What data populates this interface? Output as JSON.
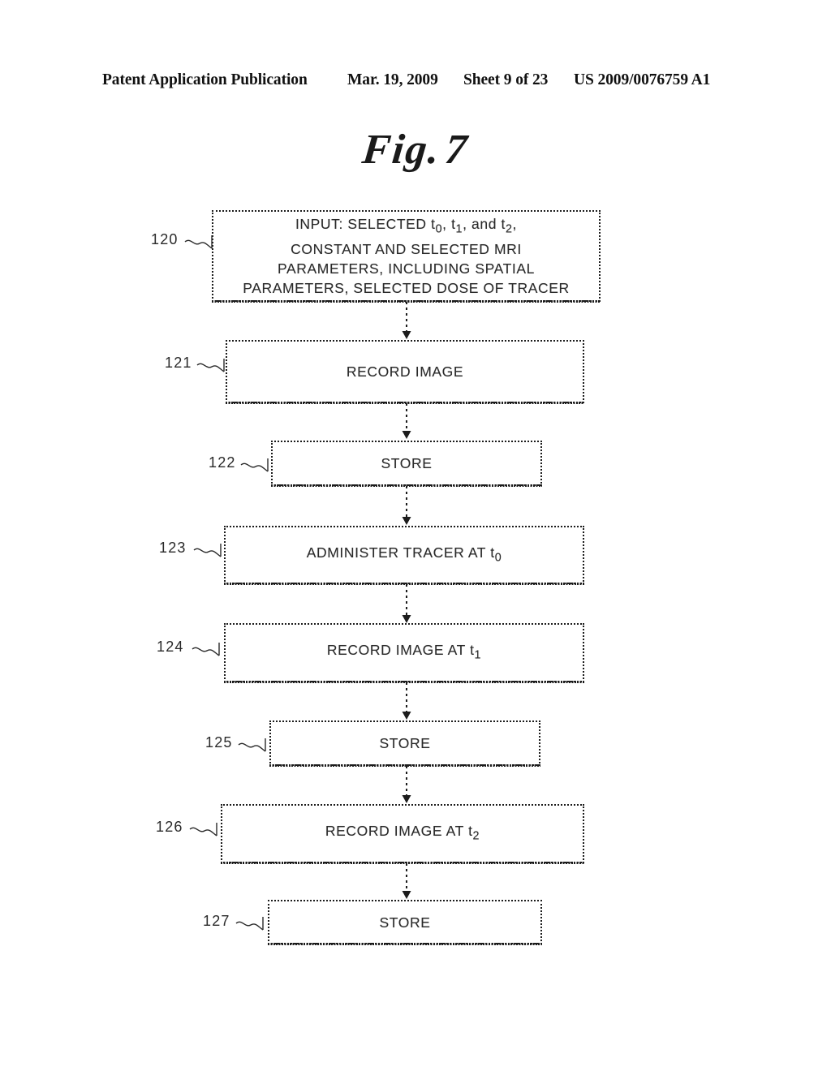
{
  "header": {
    "publication": "Patent Application Publication",
    "date": "Mar. 19, 2009",
    "sheet": "Sheet 9 of 23",
    "patent_number": "US 2009/0076759 A1"
  },
  "figure": {
    "label_word": "Fig.",
    "label_number": "7"
  },
  "chart_data": {
    "type": "diagram",
    "title": "Fig. 7",
    "diagram_kind": "flowchart",
    "orientation": "top-to-bottom",
    "connector_style": "dotted-line-with-arrowhead",
    "nodes": [
      {
        "ref": "120",
        "text": "INPUT: SELECTED t0, t1, and t2, CONSTANT AND SELECTED MRI PARAMETERS, INCLUDING SPATIAL PARAMETERS, SELECTED DOSE OF TRACER",
        "lines": [
          "INPUT: SELECTED t0, t1, and t2,",
          "CONSTANT AND SELECTED MRI",
          "PARAMETERS, INCLUDING SPATIAL",
          "PARAMETERS, SELECTED DOSE OF TRACER"
        ],
        "shape": "rectangle"
      },
      {
        "ref": "121",
        "text": "RECORD IMAGE",
        "lines": [
          "RECORD IMAGE"
        ],
        "shape": "rectangle"
      },
      {
        "ref": "122",
        "text": "STORE",
        "lines": [
          "STORE"
        ],
        "shape": "rectangle"
      },
      {
        "ref": "123",
        "text": "ADMINISTER TRACER AT t0",
        "lines": [
          "ADMINISTER TRACER AT t0"
        ],
        "shape": "rectangle"
      },
      {
        "ref": "124",
        "text": "RECORD IMAGE AT t1",
        "lines": [
          "RECORD IMAGE AT t1"
        ],
        "shape": "rectangle"
      },
      {
        "ref": "125",
        "text": "STORE",
        "lines": [
          "STORE"
        ],
        "shape": "rectangle"
      },
      {
        "ref": "126",
        "text": "RECORD IMAGE AT t2",
        "lines": [
          "RECORD IMAGE AT t2"
        ],
        "shape": "rectangle"
      },
      {
        "ref": "127",
        "text": "STORE",
        "lines": [
          "STORE"
        ],
        "shape": "rectangle"
      }
    ],
    "edges": [
      {
        "from": "120",
        "to": "121"
      },
      {
        "from": "121",
        "to": "122"
      },
      {
        "from": "122",
        "to": "123"
      },
      {
        "from": "123",
        "to": "124"
      },
      {
        "from": "124",
        "to": "125"
      },
      {
        "from": "125",
        "to": "126"
      },
      {
        "from": "126",
        "to": "127"
      }
    ]
  },
  "boxes": {
    "n120": {
      "ref": "120",
      "line1": "INPUT: SELECTED t",
      "line1_sub1": "0",
      "line1_mid": ", t",
      "line1_sub2": "1",
      "line1_mid2": ", and t",
      "line1_sub3": "2",
      "line1_end": ",",
      "line2": "CONSTANT AND SELECTED MRI",
      "line3": "PARAMETERS, INCLUDING SPATIAL",
      "line4": "PARAMETERS, SELECTED DOSE OF TRACER"
    },
    "n121": {
      "ref": "121",
      "text": "RECORD IMAGE"
    },
    "n122": {
      "ref": "122",
      "text": "STORE"
    },
    "n123": {
      "ref": "123",
      "text_pre": "ADMINISTER TRACER AT t",
      "sub": "0"
    },
    "n124": {
      "ref": "124",
      "text_pre": "RECORD IMAGE AT t",
      "sub": "1"
    },
    "n125": {
      "ref": "125",
      "text": "STORE"
    },
    "n126": {
      "ref": "126",
      "text_pre": "RECORD IMAGE AT t",
      "sub": "2"
    },
    "n127": {
      "ref": "127",
      "text": "STORE"
    }
  },
  "colors": {
    "ink": "#1c1c1c",
    "paper": "#ffffff",
    "text": "#2a2a2a"
  }
}
